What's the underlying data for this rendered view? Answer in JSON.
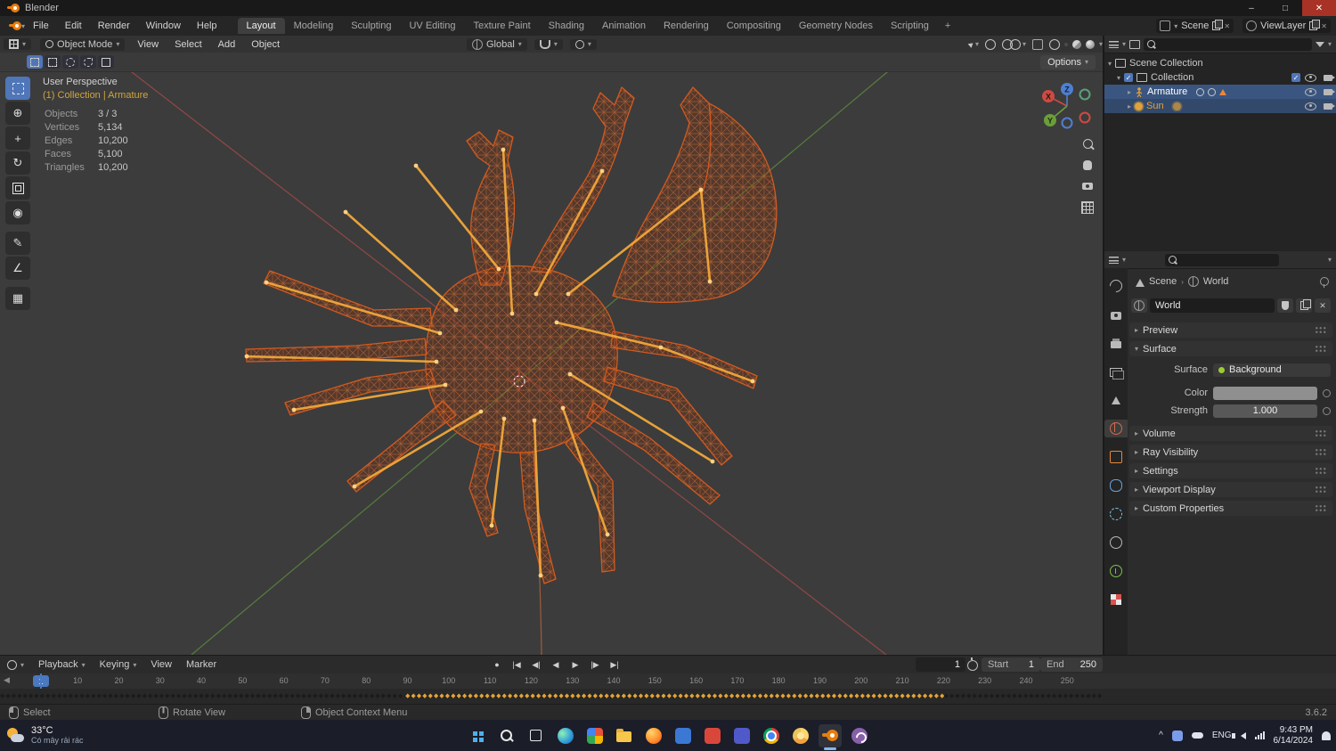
{
  "icons": {
    "caret_down": "▾",
    "caret_right": "▸",
    "check": "✓",
    "close": "✕",
    "minimize": "–",
    "maximize": "□",
    "plus": "+",
    "chevron_up": "^",
    "sep": "›"
  },
  "titlebar": {
    "title": "Blender"
  },
  "topbar": {
    "menus": [
      "File",
      "Edit",
      "Render",
      "Window",
      "Help"
    ],
    "workspaces": [
      "Layout",
      "Modeling",
      "Sculpting",
      "UV Editing",
      "Texture Paint",
      "Shading",
      "Animation",
      "Rendering",
      "Compositing",
      "Geometry Nodes",
      "Scripting"
    ],
    "add_workspace": "+",
    "scene": "Scene",
    "viewlayer": "ViewLayer"
  },
  "viewport_header": {
    "mode": "Object Mode",
    "menus": [
      "View",
      "Select",
      "Add",
      "Object"
    ],
    "orientation": "Global",
    "options": "Options"
  },
  "viewport": {
    "perspective": "User Perspective",
    "context": "(1) Collection | Armature",
    "stats_labels": [
      "Objects",
      "Vertices",
      "Edges",
      "Faces",
      "Triangles"
    ],
    "stats_values": [
      "3 / 3",
      "5,134",
      "10,200",
      "5,100",
      "10,200"
    ],
    "gizmo": {
      "x": "X",
      "y": "Y",
      "z": "Z"
    }
  },
  "outliner": {
    "rows": [
      {
        "label": "Scene Collection"
      },
      {
        "label": "Collection"
      },
      {
        "label": "Armature"
      },
      {
        "label": "Sun"
      }
    ]
  },
  "properties": {
    "breadcrumb_scene": "Scene",
    "breadcrumb_world": "World",
    "name_value": "World",
    "panels": [
      "Preview",
      "Surface",
      "Volume",
      "Ray Visibility",
      "Settings",
      "Viewport Display",
      "Custom Properties"
    ],
    "surface": {
      "label": "Surface",
      "value": "Background",
      "color_label": "Color",
      "strength_label": "Strength",
      "strength_value": "1.000"
    }
  },
  "timeline": {
    "menus": [
      "Playback",
      "Keying",
      "View",
      "Marker"
    ],
    "record": "●",
    "transport": [
      "|◀",
      "◀|",
      "◀",
      "▶",
      "|▶",
      "▶|"
    ],
    "frame_value": "1",
    "start_label": "Start",
    "start_value": "1",
    "end_label": "End",
    "end_value": "250",
    "playhead": "1",
    "back_arrow": "◀",
    "ticks": [
      "10",
      "20",
      "30",
      "40",
      "50",
      "60",
      "70",
      "80",
      "90",
      "100",
      "110",
      "120",
      "130",
      "140",
      "150",
      "160",
      "170",
      "180",
      "190",
      "200",
      "210",
      "220",
      "230",
      "240",
      "250"
    ],
    "keys_base": {
      "char": "◆",
      "count": 200
    },
    "keys_selected": {
      "char": "◆",
      "count": 100
    }
  },
  "statusbar": {
    "select": "Select",
    "rotate": "Rotate View",
    "context_menu": "Object Context Menu",
    "version": "3.6.2"
  },
  "taskbar": {
    "weather_temp": "33°C",
    "weather_desc": "Có mây rải rác",
    "language": "ENG",
    "time": "9:43 PM",
    "date": "6/14/2024"
  }
}
